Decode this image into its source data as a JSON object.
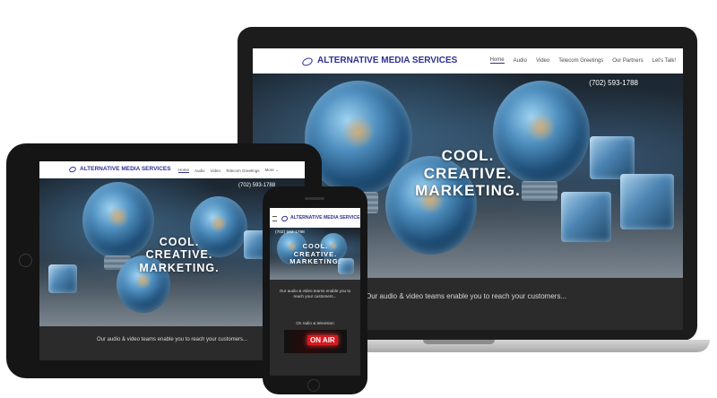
{
  "site": {
    "brand": "ALTERNATIVE MEDIA SERVICES",
    "phone": "(702) 593-1788",
    "headline": [
      "COOL.",
      "CREATIVE.",
      "MARKETING."
    ],
    "tagline": "Our audio & video teams enable you to reach your customers...",
    "colors": {
      "brand": "#2e3192",
      "dark_band": "#2b2b2b"
    }
  },
  "laptop": {
    "nav": [
      "Home",
      "Audio",
      "Video",
      "Telecom Greetings",
      "Our Partners",
      "Let's Talk!"
    ]
  },
  "tablet": {
    "nav": [
      "Home",
      "Audio",
      "Video",
      "Telecom Greetings",
      "More"
    ],
    "more_icon": "chevron-down-icon"
  },
  "phone": {
    "menu_icon": "hamburger-icon",
    "section_label": "On radio & television",
    "on_air": "ON AIR"
  }
}
